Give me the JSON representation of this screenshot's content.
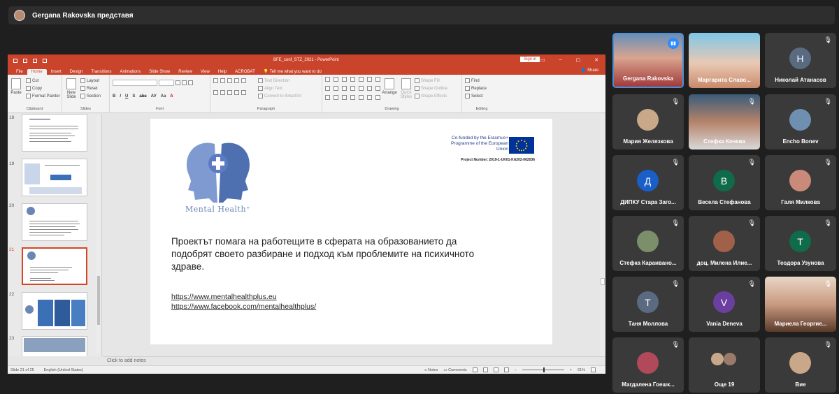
{
  "meeting": {
    "share_banner": "Gergana Rakovska представя"
  },
  "powerpoint": {
    "window_title": "BFE_conf_STZ_2021  -  PowerPoint",
    "sign_in": "Sign in",
    "tabs": [
      "File",
      "Home",
      "Insert",
      "Design",
      "Transitions",
      "Animations",
      "Slide Show",
      "Review",
      "View",
      "Help",
      "ACROBAT"
    ],
    "active_tab": "Home",
    "tell_me": "Tell me what you want to do",
    "share": "Share",
    "ribbon": {
      "clipboard": {
        "label": "Clipboard",
        "paste": "Paste",
        "cut": "Cut",
        "copy": "Copy",
        "format_painter": "Format Painter"
      },
      "slides": {
        "label": "Slides",
        "new_slide": "New Slide",
        "layout": "Layout",
        "reset": "Reset",
        "section": "Section"
      },
      "font": {
        "label": "Font"
      },
      "paragraph": {
        "label": "Paragraph",
        "text_direction": "Text Direction",
        "align_text": "Align Text",
        "convert_smartart": "Convert to SmartArt"
      },
      "drawing": {
        "label": "Drawing",
        "arrange": "Arrange",
        "quick_styles": "Quick Styles",
        "shape_fill": "Shape Fill",
        "shape_outline": "Shape Outline",
        "shape_effects": "Shape Effects"
      },
      "editing": {
        "label": "Editing",
        "find": "Find",
        "replace": "Replace",
        "select": "Select"
      }
    },
    "thumbnails": [
      {
        "num": "18"
      },
      {
        "num": "19"
      },
      {
        "num": "20"
      },
      {
        "num": "21",
        "selected": true
      },
      {
        "num": "22"
      },
      {
        "num": "23"
      }
    ],
    "slide": {
      "logo_text": "Mental Health⁺",
      "cofunded": "Co-funded by the Erasmus+ Programme of the European Union",
      "project_number": "Project Number: 2019-1-UK01-KA202-062036",
      "body": "Проектът помага на работещите в сферата на образованието да подобрят своето разбиране и подход към проблемите на психичното здраве.",
      "link1": "https://www.mentalhealthplus.eu",
      "link2": "https://www.facebook.com/mentalhealthplus/"
    },
    "notes_placeholder": "Click to add notes",
    "status": {
      "slide_of": "Slide 21 of 25",
      "language": "English (United States)",
      "notes": "Notes",
      "comments": "Comments",
      "zoom": "61%"
    }
  },
  "participants": [
    {
      "name": "Gergana Rakovska",
      "speaking": true
    },
    {
      "name": "Маргарита Славо..."
    },
    {
      "name": "Николай Атанасов",
      "initial": "Н",
      "color": "#5a6a80"
    },
    {
      "name": "Мария Желязкова"
    },
    {
      "name": "Стефка Кочева"
    },
    {
      "name": "Encho Bonev"
    },
    {
      "name": "ДИПКУ Стара Заго...",
      "initial": "Д",
      "color": "#1a5fc7"
    },
    {
      "name": "Весела Стефанова",
      "initial": "В",
      "color": "#0f6b4a"
    },
    {
      "name": "Галя Милкова"
    },
    {
      "name": "Стефка Караивано..."
    },
    {
      "name": "доц. Милена Илие..."
    },
    {
      "name": "Теодора Узунова",
      "initial": "Т",
      "color": "#0f6b4a"
    },
    {
      "name": "Таня Моллова",
      "initial": "Т",
      "color": "#5a6a80"
    },
    {
      "name": "Vania Deneva",
      "initial": "V",
      "color": "#6b3fa0"
    },
    {
      "name": "Мариела Георгие..."
    },
    {
      "name": "Магдалена Гоешк..."
    },
    {
      "name": "Още 19"
    },
    {
      "name": "Вие"
    }
  ],
  "icons": {
    "mic_muted": "mic-muted-icon",
    "speaking": "speaking-icon"
  }
}
